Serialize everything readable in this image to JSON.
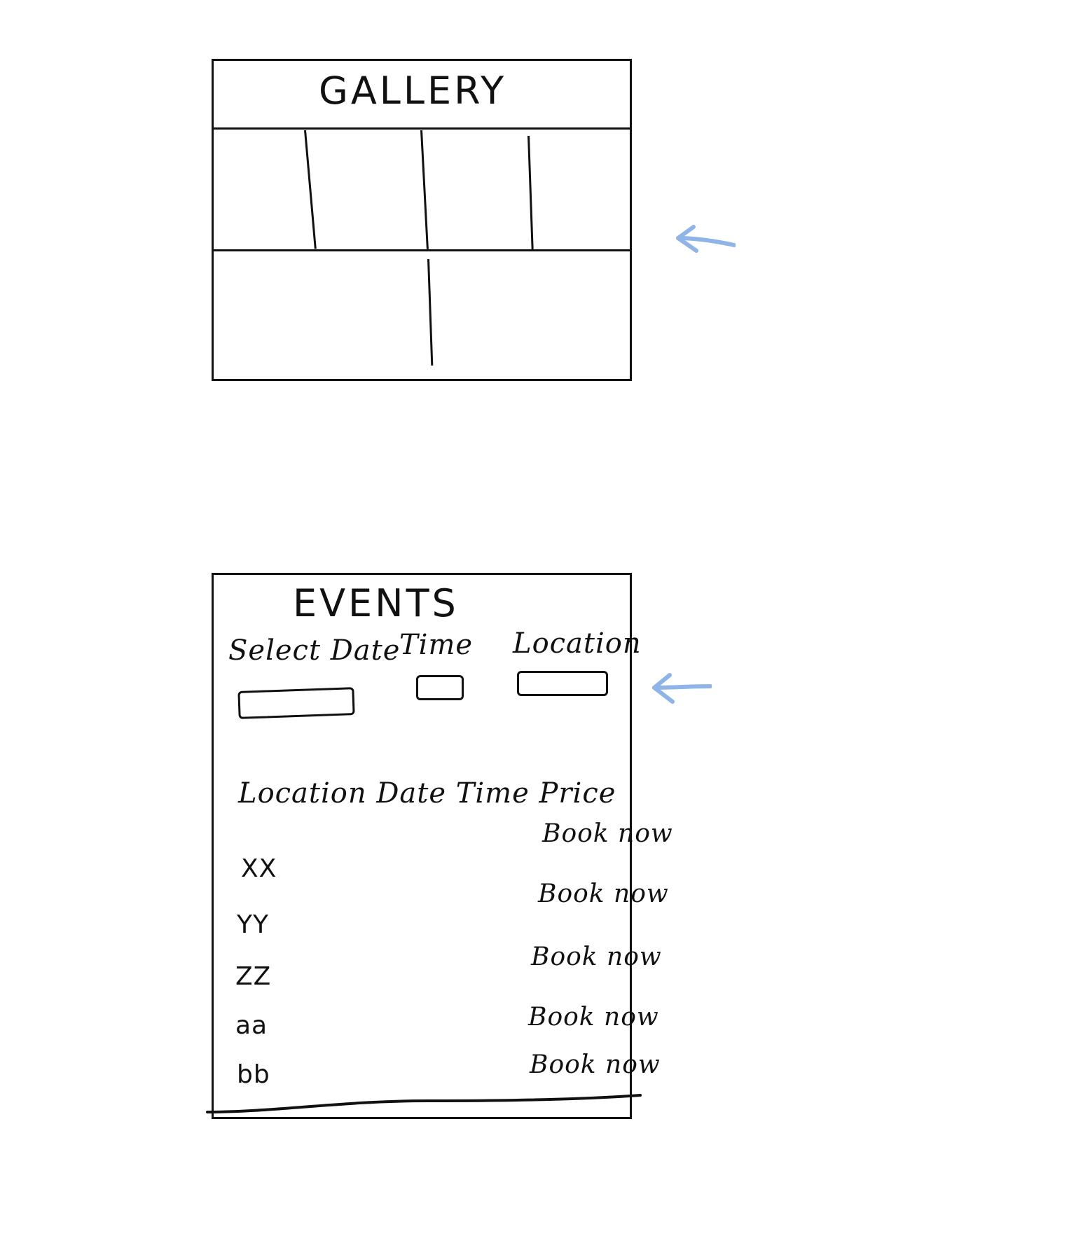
{
  "gallery": {
    "title": "GALLERY"
  },
  "events": {
    "title": "EVENTS",
    "filters": {
      "date_label": "Select Date",
      "time_label": "Time",
      "location_label": "Location"
    },
    "table": {
      "header": "Location  Date  Time  Price",
      "rows": [
        {
          "name": "XX",
          "action": "Book now"
        },
        {
          "name": "YY",
          "action": "Book now"
        },
        {
          "name": "ZZ",
          "action": "Book now"
        },
        {
          "name": "aa",
          "action": "Book now"
        },
        {
          "name": "bb",
          "action": "Book now"
        }
      ]
    }
  },
  "colors": {
    "ink": "#111111",
    "arrow": "#8fb4e8"
  },
  "icons": {
    "gallery_arrow": "left-arrow-icon",
    "events_arrow": "left-arrow-icon"
  }
}
